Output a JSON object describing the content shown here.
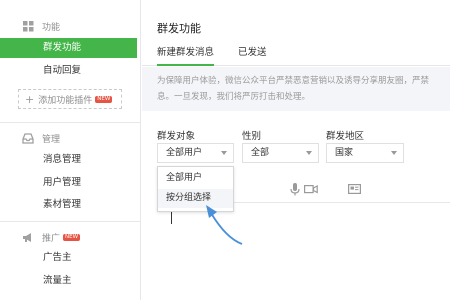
{
  "sidebar": {
    "group_function": {
      "label": "功能"
    },
    "items_function": [
      {
        "label": "群发功能",
        "active": true
      },
      {
        "label": "自动回复",
        "active": false
      }
    ],
    "add_plugin": {
      "label": "添加功能插件",
      "badge": "NEW"
    },
    "group_manage": {
      "label": "管理"
    },
    "items_manage": [
      {
        "label": "消息管理"
      },
      {
        "label": "用户管理"
      },
      {
        "label": "素材管理"
      }
    ],
    "group_promo": {
      "label": "推广",
      "badge": "NEW"
    },
    "items_promo": [
      {
        "label": "广告主"
      },
      {
        "label": "流量主"
      }
    ]
  },
  "main": {
    "title": "群发功能",
    "tabs": [
      {
        "label": "新建群发消息",
        "active": true
      },
      {
        "label": "已发送",
        "active": false
      }
    ],
    "notice": {
      "line1": "为保障用户体验，微信公众平台严禁恶意营销以及诱导分享朋友圈，严禁",
      "line2": "发布色情低俗、暴力血腥、政治谣言等各类违反法律法规及相关政策规定的信",
      "line2_visible": "息。一旦发现，我们将严厉打击和处理。"
    },
    "filters": {
      "target": {
        "label": "群发对象",
        "value": "全部用户"
      },
      "gender": {
        "label": "性别",
        "value": "全部"
      },
      "region": {
        "label": "群发地区",
        "value": "国家"
      }
    },
    "dropdown_options": [
      {
        "label": "全部用户"
      },
      {
        "label": "按分组选择",
        "hover": true
      }
    ]
  },
  "icons": {
    "function": "grid-icon",
    "manage": "inbox-icon",
    "promo": "megaphone-icon",
    "voice": "microphone-icon",
    "video": "video-camera-icon",
    "card": "card-icon"
  },
  "colors": {
    "accent": "#44b549",
    "badge": "#e65444",
    "arrow": "#4a90d9"
  }
}
